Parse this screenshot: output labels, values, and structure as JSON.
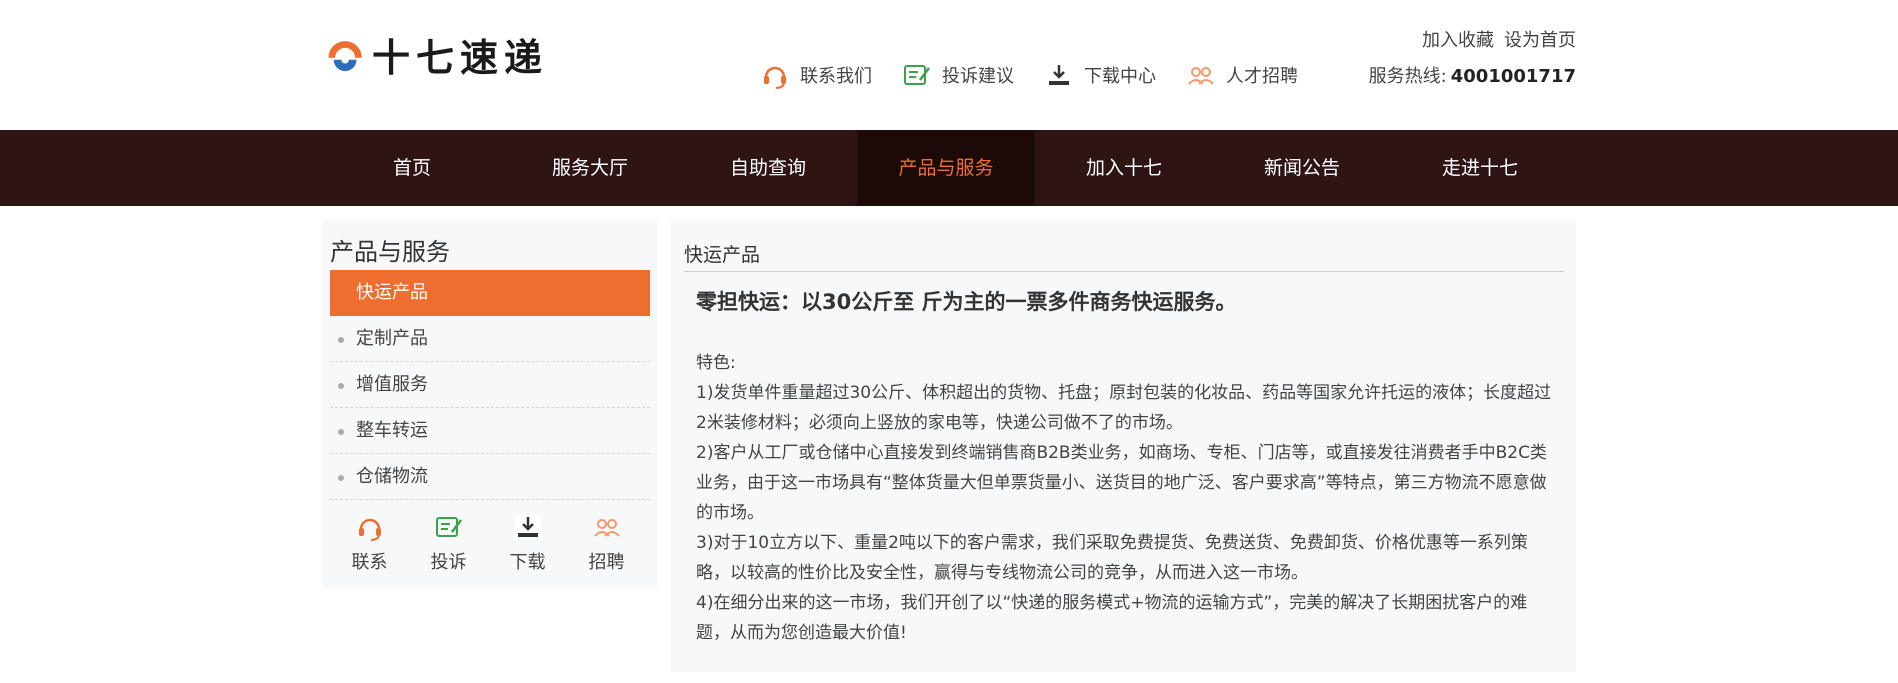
{
  "header": {
    "logo_text": "十七速递",
    "top_links": [
      "加入收藏",
      "设为首页"
    ],
    "hotline_label": "服务热线:",
    "hotline_number": "4001001717",
    "quick_nav": [
      {
        "label": "联系我们",
        "icon": "headset-icon"
      },
      {
        "label": "投诉建议",
        "icon": "feedback-icon"
      },
      {
        "label": "下载中心",
        "icon": "download-icon"
      },
      {
        "label": "人才招聘",
        "icon": "people-icon"
      }
    ]
  },
  "nav": {
    "items": [
      "首页",
      "服务大厅",
      "自助查询",
      "产品与服务",
      "加入十七",
      "新闻公告",
      "走进十七"
    ],
    "active_index": 3
  },
  "sidebar": {
    "title": "产品与服务",
    "items": [
      "快运产品",
      "定制产品",
      "增值服务",
      "整车转运",
      "仓储物流"
    ],
    "active_index": 0,
    "icons": [
      {
        "label": "联系",
        "icon": "headset-icon"
      },
      {
        "label": "投诉",
        "icon": "feedback-icon"
      },
      {
        "label": "下载",
        "icon": "download-icon"
      },
      {
        "label": "招聘",
        "icon": "people-icon"
      }
    ]
  },
  "content": {
    "title": "快运产品",
    "headline": "零担快运：以30公斤至 斤为主的一票多件商务快运服务。",
    "paragraphs": [
      "特色:",
      "1)发货单件重量超过30公斤、体积超出的货物、托盘；原封包装的化妆品、药品等国家允许托运的液体；长度超过2米装修材料；必须向上竖放的家电等，快递公司做不了的市场。",
      "2)客户从工厂或仓储中心直接发到终端销售商B2B类业务，如商场、专柜、门店等，或直接发往消费者手中B2C类业务，由于这一市场具有“整体货量大但单票货量小、送货目的地广泛、客户要求高”等特点，第三方物流不愿意做的市场。",
      "3)对于10立方以下、重量2吨以下的客户需求，我们采取免费提货、免费送货、免费卸货、价格优惠等一系列策略，以较高的性价比及安全性，赢得与专线物流公司的竞争，从而进入这一市场。",
      "4)在细分出来的这一市场，我们开创了以“快递的服务模式+物流的运输方式”，完美的解决了长期困扰客户的难题，从而为您创造最大价值!"
    ]
  },
  "colors": {
    "nav_bg": "#2e1514",
    "accent": "#ee6e30",
    "green": "#3aa34a"
  }
}
